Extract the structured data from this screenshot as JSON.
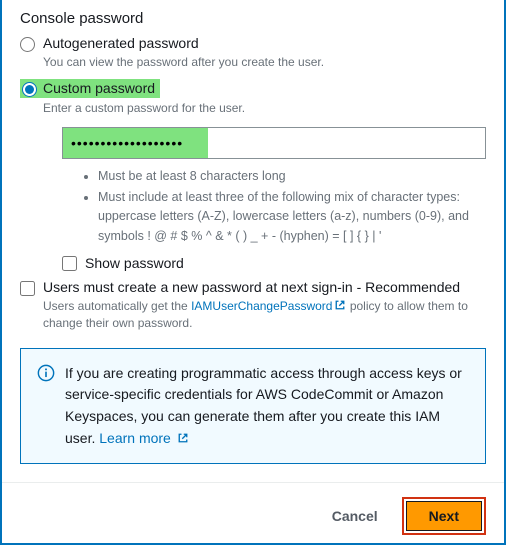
{
  "section_title": "Console password",
  "autogen": {
    "label": "Autogenerated password",
    "helper": "You can view the password after you create the user."
  },
  "custom": {
    "label": "Custom password",
    "helper": "Enter a custom password for the user.",
    "value": "•••••••••••••••••••"
  },
  "requirements": {
    "r1": "Must be at least 8 characters long",
    "r2": "Must include at least three of the following mix of character types: uppercase letters (A-Z), lowercase letters (a-z), numbers (0-9), and symbols ! @ # $ % ^ & * ( ) _ + - (hyphen) = [ ] { } | '"
  },
  "show_password_label": "Show password",
  "force_change": {
    "label": "Users must create a new password at next sign-in - Recommended",
    "helper_pre": "Users automatically get the ",
    "helper_link": "IAMUserChangePassword",
    "helper_post": " policy to allow them to change their own password."
  },
  "info": {
    "text": "If you are creating programmatic access through access keys or service-specific credentials for AWS CodeCommit or Amazon Keyspaces, you can generate them after you create this IAM user. ",
    "link": "Learn more"
  },
  "footer": {
    "cancel": "Cancel",
    "next": "Next"
  }
}
